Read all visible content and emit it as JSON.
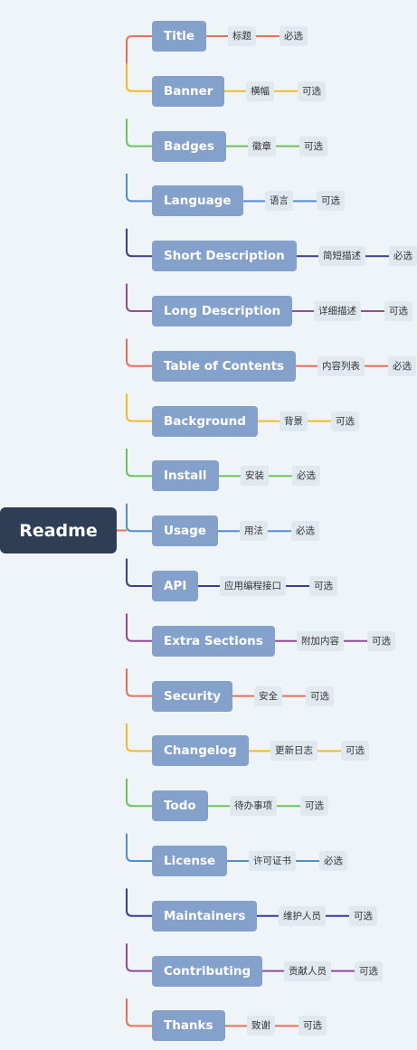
{
  "root": {
    "label": "Readme"
  },
  "colors": {
    "background": "#eef4f8",
    "root_fill": "#2f3e55",
    "branch_fill": "#84a1cb",
    "leaf_fill": "#e0e8f0",
    "red": "#e8705a",
    "yellow": "#f5b922",
    "green": "#6cc35b",
    "blue": "#4f8ed0",
    "indigo": "#3c3d8f",
    "purple": "#944a96"
  },
  "branches": [
    {
      "label": "Title",
      "desc": "标题",
      "req": "必选",
      "color": "#e8705a"
    },
    {
      "label": "Banner",
      "desc": "横幅",
      "req": "可选",
      "color": "#f5b922"
    },
    {
      "label": "Badges",
      "desc": "徽章",
      "req": "可选",
      "color": "#6cc35b"
    },
    {
      "label": "Language",
      "desc": "语言",
      "req": "可选",
      "color": "#4f8ed0"
    },
    {
      "label": "Short Description",
      "desc": "简短描述",
      "req": "必选",
      "color": "#3c3d8f"
    },
    {
      "label": "Long Description",
      "desc": "详细描述",
      "req": "可选",
      "color": "#944a96"
    },
    {
      "label": "Table of Contents",
      "desc": "内容列表",
      "req": "必选",
      "color": "#e8705a"
    },
    {
      "label": "Background",
      "desc": "背景",
      "req": "可选",
      "color": "#f5b922"
    },
    {
      "label": "Install",
      "desc": "安装",
      "req": "必选",
      "color": "#6cc35b"
    },
    {
      "label": "Usage",
      "desc": "用法",
      "req": "必选",
      "color": "#4f8ed0"
    },
    {
      "label": "API",
      "desc": "应用编程接口",
      "req": "可选",
      "color": "#3c3d8f"
    },
    {
      "label": "Extra Sections",
      "desc": "附加内容",
      "req": "可选",
      "color": "#944a96"
    },
    {
      "label": "Security",
      "desc": "安全",
      "req": "可选",
      "color": "#e8705a"
    },
    {
      "label": "Changelog",
      "desc": "更新日志",
      "req": "可选",
      "color": "#f5b922"
    },
    {
      "label": "Todo",
      "desc": "待办事项",
      "req": "可选",
      "color": "#6cc35b"
    },
    {
      "label": "License",
      "desc": "许可证书",
      "req": "必选",
      "color": "#4f8ed0"
    },
    {
      "label": "Maintainers",
      "desc": "维护人员",
      "req": "可选",
      "color": "#3c3d8f"
    },
    {
      "label": "Contributing",
      "desc": "贡献人员",
      "req": "可选",
      "color": "#944a96"
    },
    {
      "label": "Thanks",
      "desc": "致谢",
      "req": "可选",
      "color": "#e8705a"
    }
  ]
}
